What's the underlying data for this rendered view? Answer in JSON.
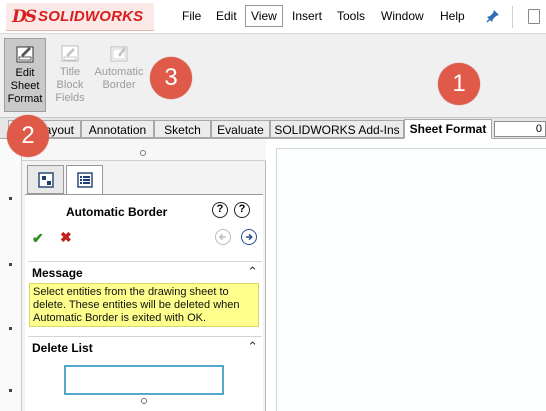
{
  "app": {
    "logo_text": "SOLIDWORKS",
    "brand_color": "#d81e1e"
  },
  "menu": {
    "items": [
      "File",
      "Edit",
      "View",
      "Insert",
      "Tools",
      "Window",
      "Help"
    ],
    "active": "View"
  },
  "ribbon": {
    "buttons": [
      {
        "label": "Edit\nSheet\nFormat",
        "icon": "edit-sheet-format-icon",
        "state": "pressed"
      },
      {
        "label": "Title\nBlock\nFields",
        "icon": "title-block-fields-icon",
        "state": "disabled"
      },
      {
        "label": "Automatic\nBorder",
        "icon": "automatic-border-icon",
        "state": "disabled"
      }
    ]
  },
  "tabs": {
    "items": [
      "Layout",
      "Annotation",
      "Sketch",
      "Evaluate",
      "SOLIDWORKS Add-Ins",
      "Sheet Format"
    ],
    "active": "Sheet Format",
    "field_value": "0"
  },
  "property_manager": {
    "title": "Automatic Border",
    "help_labels": [
      "?",
      "?"
    ],
    "message_section": {
      "title": "Message",
      "text": "Select entities from the drawing sheet to delete. These entities will be deleted when Automatic Border is exited with OK."
    },
    "delete_list_section": {
      "title": "Delete List",
      "value": ""
    }
  },
  "callouts": [
    "1",
    "2",
    "3"
  ],
  "colors": {
    "message_bg": "#ffff8d",
    "callout": "#e05a4a",
    "ok": "#2e8b1f",
    "cancel": "#c1221b",
    "selection_box": "#56a7d0"
  }
}
